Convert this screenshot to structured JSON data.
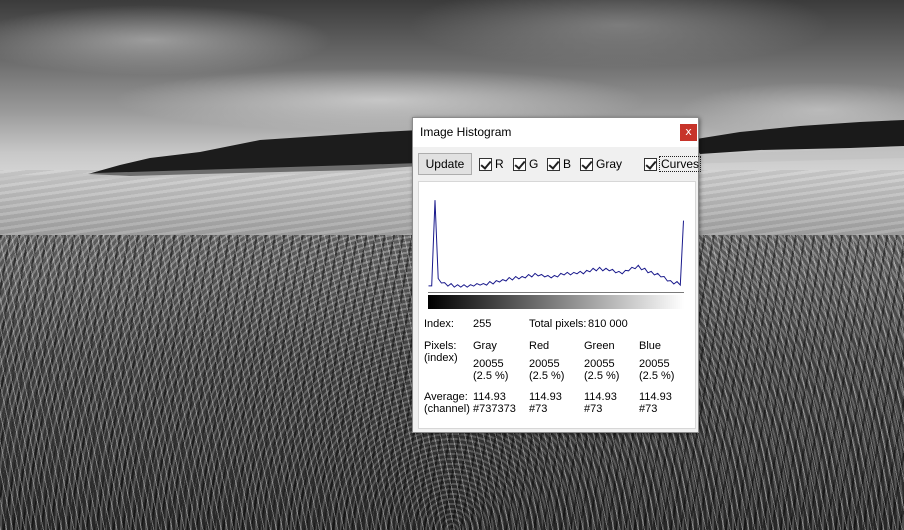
{
  "window": {
    "title": "Image Histogram",
    "close_glyph": "x"
  },
  "toolbar": {
    "update_label": "Update",
    "checkboxes": [
      {
        "label": "R",
        "checked": true
      },
      {
        "label": "G",
        "checked": true
      },
      {
        "label": "B",
        "checked": true
      },
      {
        "label": "Gray",
        "checked": true
      },
      {
        "label": "Curves",
        "checked": true
      }
    ]
  },
  "stats": {
    "index_label": "Index:",
    "index_value": "255",
    "total_label": "Total pixels:",
    "total_value": "810 000",
    "pixels_label": "Pixels:",
    "pixels_sub": "(index)",
    "average_label": "Average:",
    "average_sub": "(channel)",
    "channels": [
      {
        "name": "Gray",
        "count": "20055",
        "percent": "(2.5 %)",
        "average": "114.93",
        "hex": "#737373"
      },
      {
        "name": "Red",
        "count": "20055",
        "percent": "(2.5 %)",
        "average": "114.93",
        "hex": "#73"
      },
      {
        "name": "Green",
        "count": "20055",
        "percent": "(2.5 %)",
        "average": "114.93",
        "hex": "#73"
      },
      {
        "name": "Blue",
        "count": "20055",
        "percent": "(2.5 %)",
        "average": "114.93",
        "hex": "#73"
      }
    ]
  },
  "colors": {
    "curve": "#1a1a8c",
    "close_button": "#c7342a"
  },
  "chart_data": {
    "type": "line",
    "x_range": [
      0,
      255
    ],
    "series": [
      {
        "values": [
          6,
          6,
          90,
          12,
          10,
          8,
          7,
          7,
          6,
          6,
          6,
          6,
          6,
          6,
          7,
          7,
          8,
          7,
          8,
          9,
          9,
          10,
          11,
          11,
          12,
          13,
          13,
          14,
          14,
          14,
          15,
          16,
          16,
          17,
          17,
          16,
          16,
          15,
          15,
          15,
          16,
          17,
          18,
          18,
          18,
          18,
          19,
          19,
          19,
          20,
          21,
          22,
          22,
          23,
          22,
          22,
          22,
          21,
          20,
          19,
          19,
          20,
          22,
          23,
          24,
          25,
          23,
          22,
          20,
          19,
          18,
          17,
          16,
          14,
          12,
          10,
          9,
          9,
          8,
          70
        ]
      }
    ]
  }
}
